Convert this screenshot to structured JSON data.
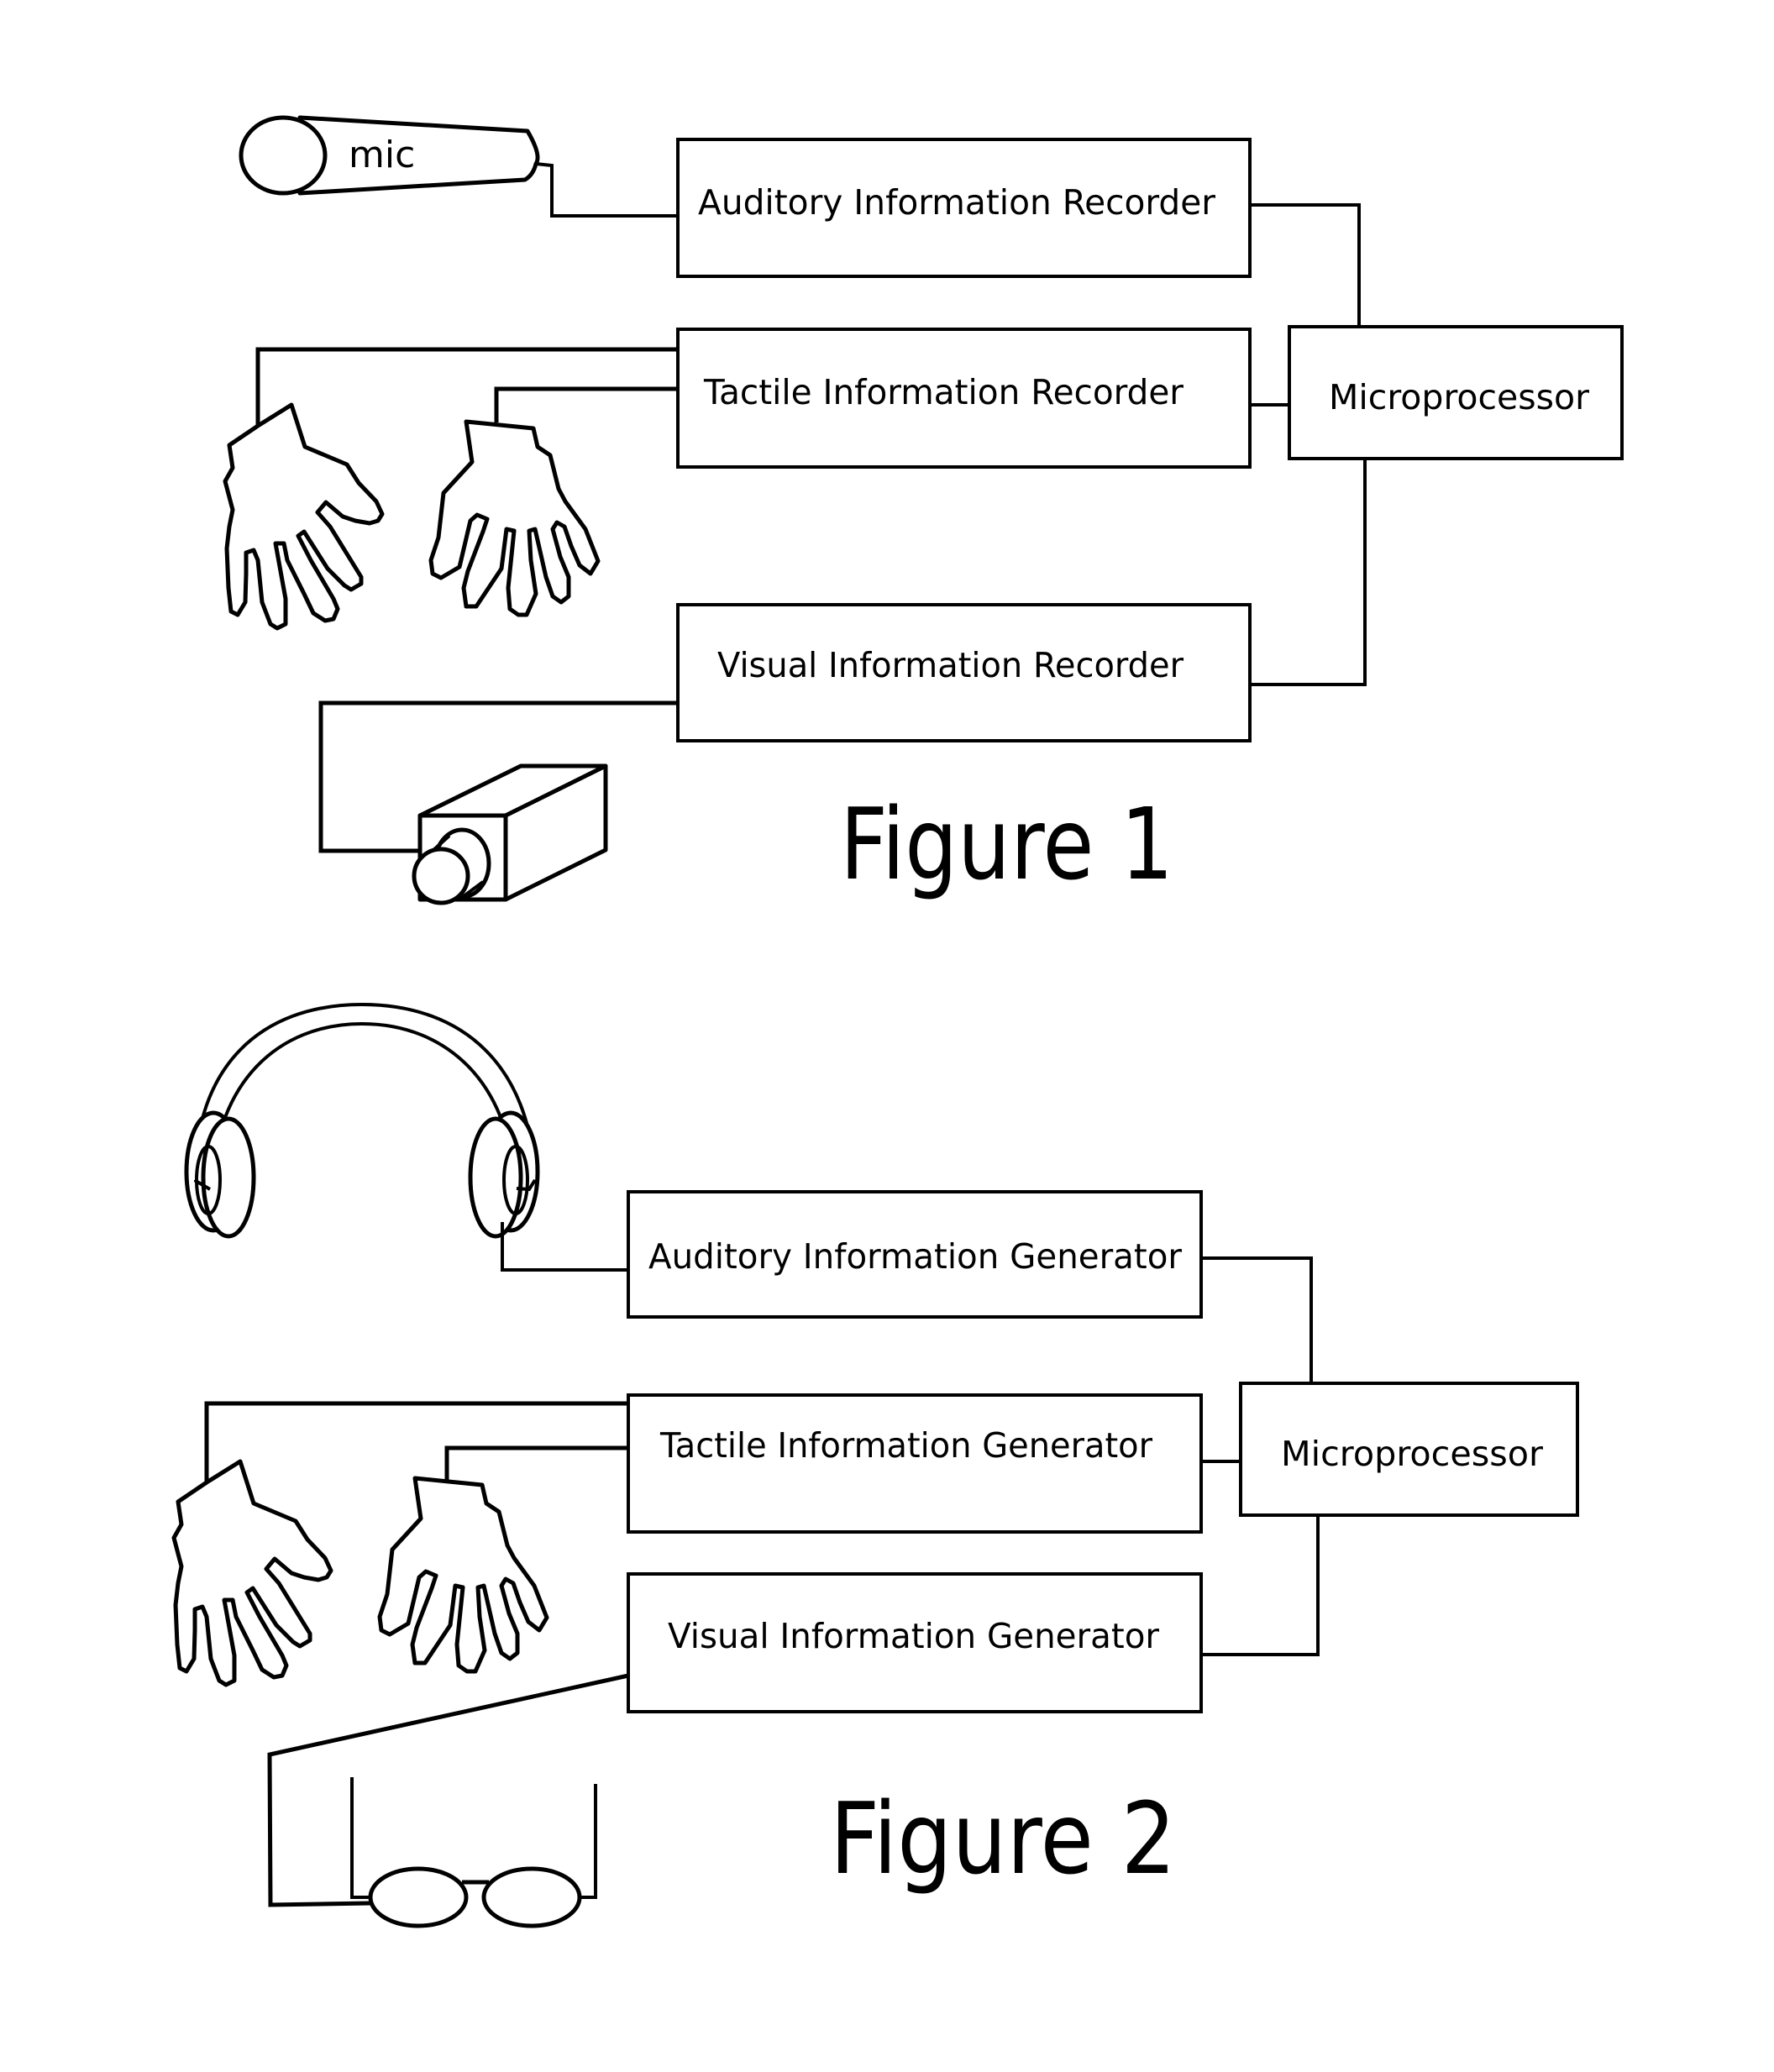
{
  "figures": [
    {
      "title": "Figure 1",
      "devices": {
        "microphone_label": "mic",
        "hands": "hand-pair",
        "camera": "video-camera"
      },
      "blocks": {
        "auditory": "Auditory Information Recorder",
        "tactile": "Tactile Information Recorder",
        "visual": "Visual Information Recorder",
        "processor": "Microprocessor"
      },
      "connections": [
        [
          "microphone",
          "auditory"
        ],
        [
          "left-hand",
          "tactile"
        ],
        [
          "right-hand",
          "tactile"
        ],
        [
          "camera",
          "visual"
        ],
        [
          "auditory",
          "processor"
        ],
        [
          "tactile",
          "processor"
        ],
        [
          "visual",
          "processor"
        ]
      ]
    },
    {
      "title": "Figure 2",
      "devices": {
        "headphones": "headphones",
        "hands": "hand-pair",
        "glasses": "eyeglasses"
      },
      "blocks": {
        "auditory": "Auditory Information Generator",
        "tactile": "Tactile Information Generator",
        "visual": "Visual Information Generator",
        "processor": "Microprocessor"
      },
      "connections": [
        [
          "headphones",
          "auditory"
        ],
        [
          "left-hand",
          "tactile"
        ],
        [
          "right-hand",
          "tactile"
        ],
        [
          "glasses",
          "visual"
        ],
        [
          "auditory",
          "processor"
        ],
        [
          "tactile",
          "processor"
        ],
        [
          "visual",
          "processor"
        ]
      ]
    }
  ]
}
